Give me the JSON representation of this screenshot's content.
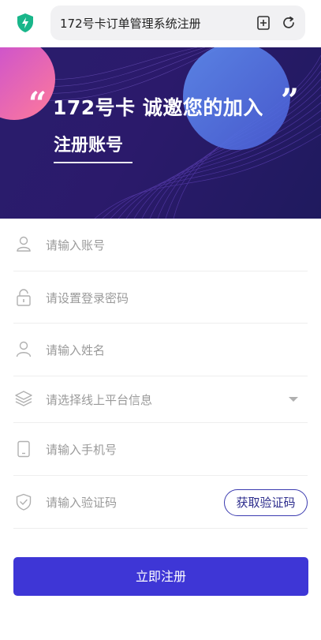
{
  "browser": {
    "url_text": "172号卡订单管理系统注册",
    "icons": [
      "shield-icon",
      "add-bookmark-icon",
      "reload-icon"
    ]
  },
  "banner": {
    "title": "172号卡 诚邀您的加入",
    "subtitle": "注册账号",
    "quote_open": "“",
    "quote_close": "”"
  },
  "form": {
    "account_placeholder": "请输入账号",
    "password_placeholder": "请设置登录密码",
    "name_placeholder": "请输入姓名",
    "platform_placeholder": "请选择线上平台信息",
    "phone_placeholder": "请输入手机号",
    "code_placeholder": "请输入验证码",
    "get_code_label": "获取验证码",
    "submit_label": "立即注册"
  },
  "colors": {
    "accent": "#3e36d6",
    "banner_bg": "#2a1d6d",
    "shield": "#19b68a",
    "placeholder": "#9a9a9a"
  }
}
